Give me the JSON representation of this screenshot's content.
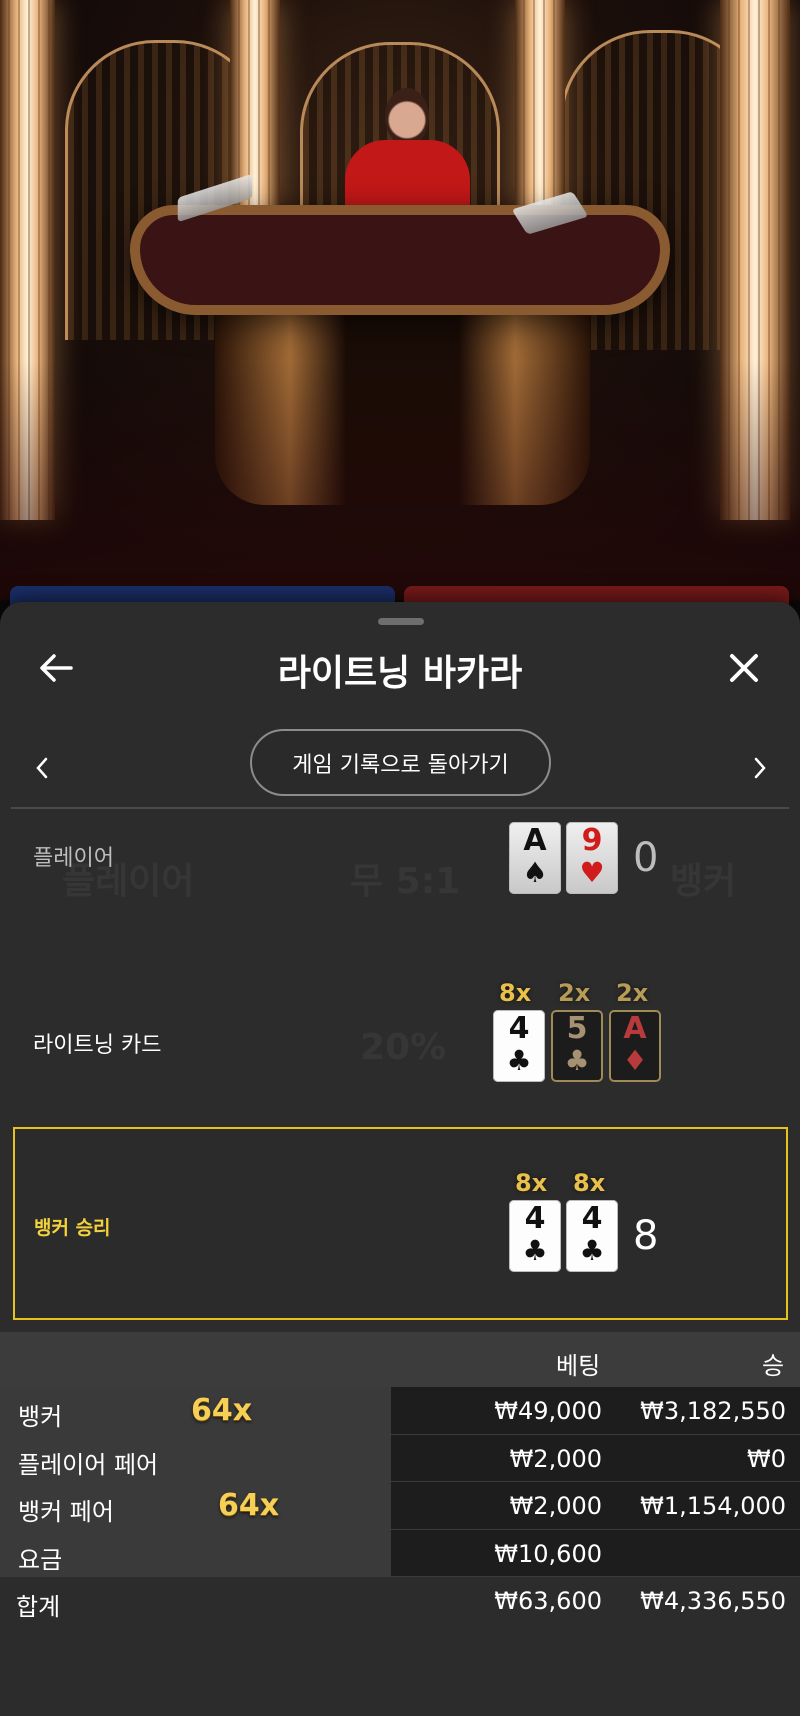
{
  "sheet": {
    "title": "라이트닝 바카라",
    "back_to_history": "게임 기록으로 돌아가기"
  },
  "ghost_texts": [
    "플레이어",
    "무 5:1",
    "뱅커",
    "20%"
  ],
  "player_row": {
    "label": "플레이어",
    "cards": [
      {
        "rank": "A",
        "suit": "♠",
        "color": "black"
      },
      {
        "rank": "9",
        "suit": "♥",
        "color": "red"
      }
    ],
    "score": "0"
  },
  "lightning_row": {
    "label": "라이트닝 카드",
    "cards": [
      {
        "rank": "4",
        "suit": "♣",
        "multiplier": "8x"
      },
      {
        "rank": "5",
        "suit": "♣",
        "multiplier": "2x"
      },
      {
        "rank": "A",
        "suit": "♦",
        "multiplier": "2x"
      }
    ]
  },
  "banker_row": {
    "label": "뱅커 승리",
    "cards": [
      {
        "rank": "4",
        "suit": "♣",
        "multiplier": "8x"
      },
      {
        "rank": "4",
        "suit": "♣",
        "multiplier": "8x"
      }
    ],
    "score": "8"
  },
  "results_table": {
    "header": {
      "bet": "베팅",
      "win": "승"
    },
    "rows": [
      {
        "label": "뱅커",
        "badge": "64x",
        "bet": "₩49,000",
        "win": "₩3,182,550"
      },
      {
        "label": "플레이어 페어",
        "badge": "",
        "bet": "₩2,000",
        "win": "₩0"
      },
      {
        "label": "뱅커 페어",
        "badge": "64x",
        "bet": "₩2,000",
        "win": "₩1,154,000"
      },
      {
        "label": "요금",
        "badge": "",
        "bet": "₩10,600",
        "win": ""
      }
    ],
    "total": {
      "label": "합계",
      "bet": "₩63,600",
      "win": "₩4,336,550"
    }
  },
  "colors": {
    "sheet_bg": "#2c2c2c",
    "gold": "#e6c21a",
    "banker_red": "#7a1a1a",
    "player_blue": "#1b2f6a"
  }
}
